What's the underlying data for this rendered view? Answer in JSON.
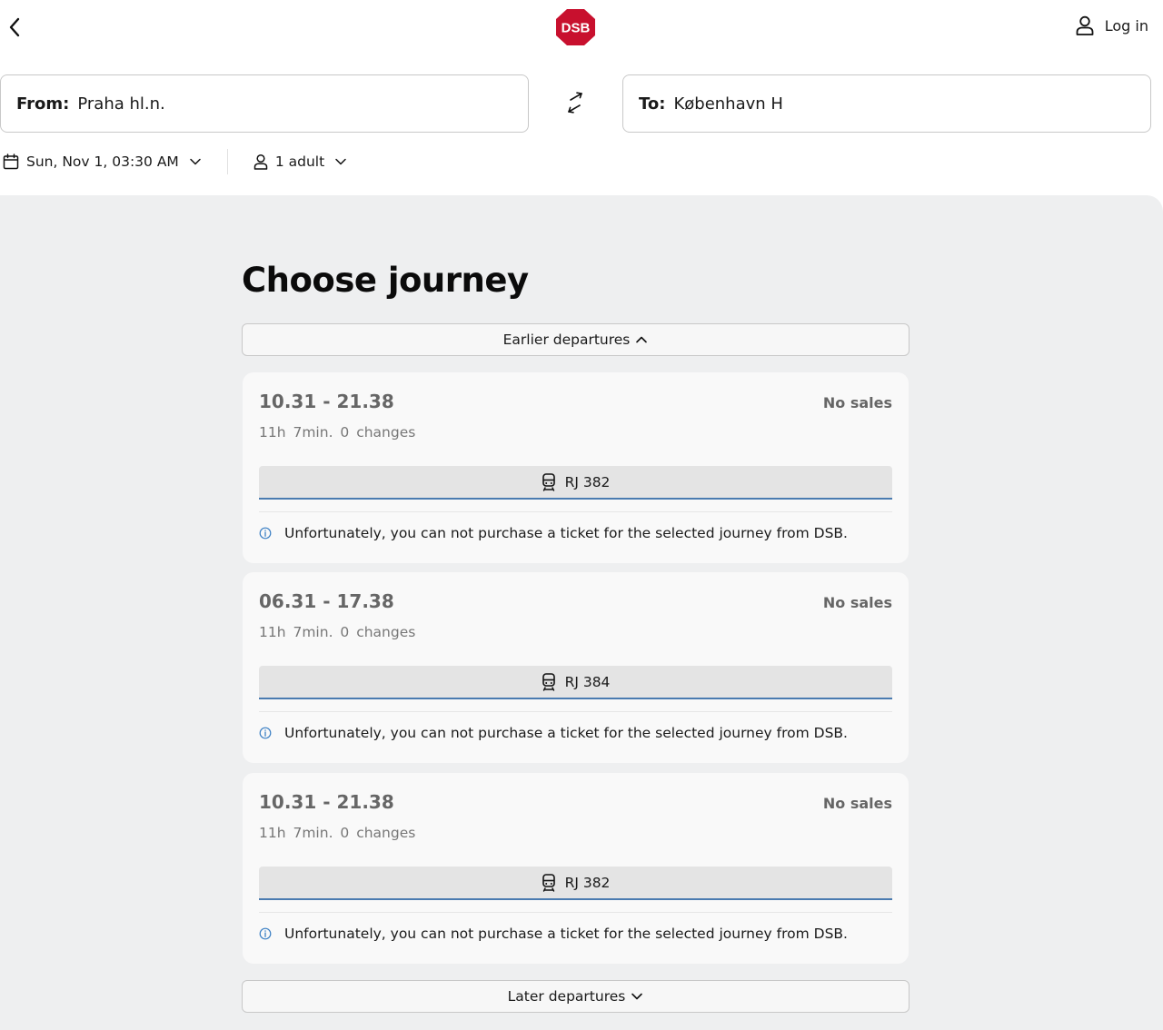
{
  "header": {
    "brand": "DSB",
    "login_label": "Log in"
  },
  "search": {
    "from_label": "From:",
    "from_value": "Praha hl.n.",
    "to_label": "To:",
    "to_value": "København H",
    "datetime": "Sun, Nov 1, 03:30 AM",
    "passengers": "1 adult"
  },
  "main": {
    "title": "Choose journey",
    "earlier_label": "Earlier departures",
    "later_label": "Later departures",
    "journeys": [
      {
        "time": "10.31 - 21.38",
        "status": "No sales",
        "meta": "11h 7min. 0 changes",
        "train": "RJ 382",
        "note": "Unfortunately, you can not purchase a ticket for the selected journey from DSB."
      },
      {
        "time": "06.31 - 17.38",
        "status": "No sales",
        "meta": "11h 7min. 0 changes",
        "train": "RJ 384",
        "note": "Unfortunately, you can not purchase a ticket for the selected journey from DSB."
      },
      {
        "time": "10.31 - 21.38",
        "status": "No sales",
        "meta": "11h 7min. 0 changes",
        "train": "RJ 382",
        "note": "Unfortunately, you can not purchase a ticket for the selected journey from DSB."
      }
    ]
  },
  "colors": {
    "brand_red": "#c8102e",
    "main_bg": "#eeeff0",
    "card_bg": "#f9f9f9",
    "accent_blue": "#4a7bb0"
  }
}
